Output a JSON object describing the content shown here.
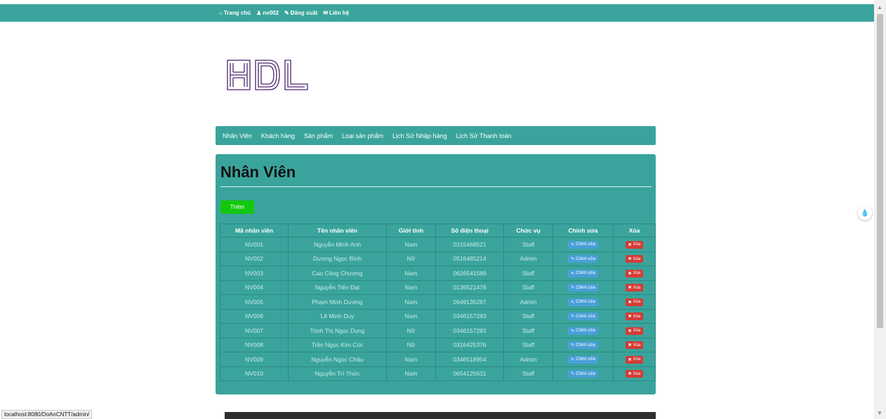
{
  "topnav": {
    "items": [
      {
        "icon": "home-icon",
        "label": "Trang chủ"
      },
      {
        "icon": "user-icon",
        "label": "nv002"
      },
      {
        "icon": "edit-icon",
        "label": "Đăng xuất"
      },
      {
        "icon": "mail-icon",
        "label": "Liên hệ"
      }
    ]
  },
  "logo": {
    "text": "HDL"
  },
  "mainnav": {
    "items": [
      "Nhân Viên",
      "Khách hàng",
      "Sản phẩm",
      "Loại sản phẩm",
      "Lịch Sử Nhập hàng",
      "Lịch Sử Thanh toán"
    ]
  },
  "page": {
    "title": "Nhân Viên",
    "add_label": "Thêm"
  },
  "table": {
    "headers": [
      "Mã nhân viên",
      "Tên nhân viên",
      "Giới tính",
      "Số điện thoại",
      "Chức vụ",
      "Chỉnh sửa",
      "Xóa"
    ],
    "edit_label": "Chỉnh sửa",
    "delete_label": "Xóa",
    "rows": [
      [
        "NV001",
        "Nguyễn Minh Anh",
        "Nam",
        "0315468521",
        "Staff"
      ],
      [
        "NV002",
        "Dương Ngọc Bình",
        "Nữ",
        "0516485214",
        "Admin"
      ],
      [
        "NV003",
        "Cao Công Chương",
        "Nam",
        "0626541589",
        "Staff"
      ],
      [
        "NV004",
        "Nguyễn Tiến Đạt",
        "Nam",
        "0136521478",
        "Staff"
      ],
      [
        "NV005",
        "Phạm Minh Dương",
        "Nam",
        "0649135287",
        "Admin"
      ],
      [
        "NV006",
        "Lê Minh Duy",
        "Nam",
        "0346157283",
        "Staff"
      ],
      [
        "NV007",
        "Trịnh Thị Ngọc Dung",
        "Nữ",
        "0346157283",
        "Staff"
      ],
      [
        "NV008",
        "Trần Ngọc Kim Cúc",
        "Nữ",
        "0316425376",
        "Staff"
      ],
      [
        "NV009",
        "Nguyễn Ngọc Châu",
        "Nam",
        "0346518954",
        "Admin"
      ],
      [
        "NV010",
        "Nguyễn Trí Thức",
        "Nam",
        "0654125631",
        "Staff"
      ]
    ]
  },
  "status": {
    "url": "localhost:8080/DoAnCNTT/admin/"
  },
  "colors": {
    "accent": "#3aa49c",
    "add": "#12c80d",
    "edit": "#4a9fd8",
    "delete": "#d33c36"
  }
}
